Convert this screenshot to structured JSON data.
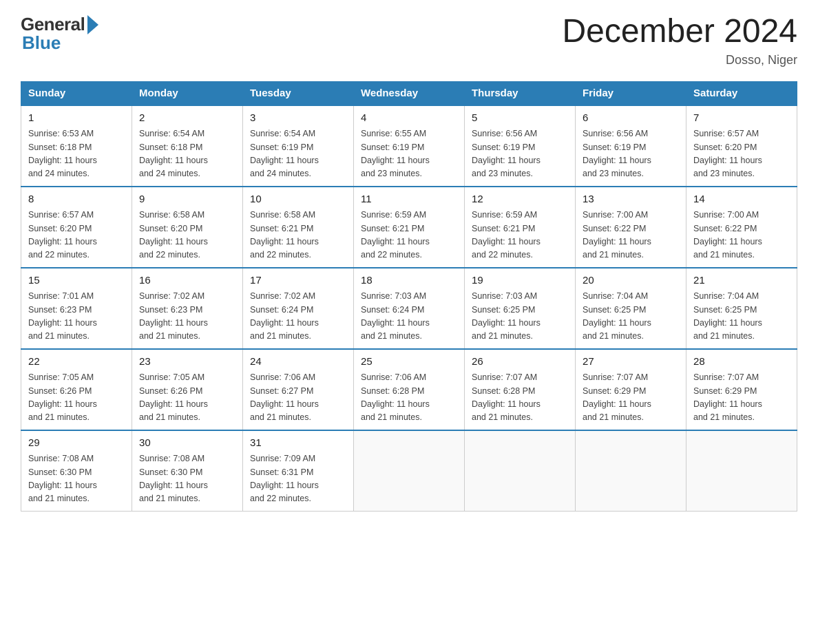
{
  "header": {
    "logo_general": "General",
    "logo_blue": "Blue",
    "title": "December 2024",
    "location": "Dosso, Niger"
  },
  "calendar": {
    "days_of_week": [
      "Sunday",
      "Monday",
      "Tuesday",
      "Wednesday",
      "Thursday",
      "Friday",
      "Saturday"
    ],
    "weeks": [
      [
        {
          "day": "1",
          "sunrise": "6:53 AM",
          "sunset": "6:18 PM",
          "daylight": "11 hours and 24 minutes."
        },
        {
          "day": "2",
          "sunrise": "6:54 AM",
          "sunset": "6:18 PM",
          "daylight": "11 hours and 24 minutes."
        },
        {
          "day": "3",
          "sunrise": "6:54 AM",
          "sunset": "6:19 PM",
          "daylight": "11 hours and 24 minutes."
        },
        {
          "day": "4",
          "sunrise": "6:55 AM",
          "sunset": "6:19 PM",
          "daylight": "11 hours and 23 minutes."
        },
        {
          "day": "5",
          "sunrise": "6:56 AM",
          "sunset": "6:19 PM",
          "daylight": "11 hours and 23 minutes."
        },
        {
          "day": "6",
          "sunrise": "6:56 AM",
          "sunset": "6:19 PM",
          "daylight": "11 hours and 23 minutes."
        },
        {
          "day": "7",
          "sunrise": "6:57 AM",
          "sunset": "6:20 PM",
          "daylight": "11 hours and 23 minutes."
        }
      ],
      [
        {
          "day": "8",
          "sunrise": "6:57 AM",
          "sunset": "6:20 PM",
          "daylight": "11 hours and 22 minutes."
        },
        {
          "day": "9",
          "sunrise": "6:58 AM",
          "sunset": "6:20 PM",
          "daylight": "11 hours and 22 minutes."
        },
        {
          "day": "10",
          "sunrise": "6:58 AM",
          "sunset": "6:21 PM",
          "daylight": "11 hours and 22 minutes."
        },
        {
          "day": "11",
          "sunrise": "6:59 AM",
          "sunset": "6:21 PM",
          "daylight": "11 hours and 22 minutes."
        },
        {
          "day": "12",
          "sunrise": "6:59 AM",
          "sunset": "6:21 PM",
          "daylight": "11 hours and 22 minutes."
        },
        {
          "day": "13",
          "sunrise": "7:00 AM",
          "sunset": "6:22 PM",
          "daylight": "11 hours and 21 minutes."
        },
        {
          "day": "14",
          "sunrise": "7:00 AM",
          "sunset": "6:22 PM",
          "daylight": "11 hours and 21 minutes."
        }
      ],
      [
        {
          "day": "15",
          "sunrise": "7:01 AM",
          "sunset": "6:23 PM",
          "daylight": "11 hours and 21 minutes."
        },
        {
          "day": "16",
          "sunrise": "7:02 AM",
          "sunset": "6:23 PM",
          "daylight": "11 hours and 21 minutes."
        },
        {
          "day": "17",
          "sunrise": "7:02 AM",
          "sunset": "6:24 PM",
          "daylight": "11 hours and 21 minutes."
        },
        {
          "day": "18",
          "sunrise": "7:03 AM",
          "sunset": "6:24 PM",
          "daylight": "11 hours and 21 minutes."
        },
        {
          "day": "19",
          "sunrise": "7:03 AM",
          "sunset": "6:25 PM",
          "daylight": "11 hours and 21 minutes."
        },
        {
          "day": "20",
          "sunrise": "7:04 AM",
          "sunset": "6:25 PM",
          "daylight": "11 hours and 21 minutes."
        },
        {
          "day": "21",
          "sunrise": "7:04 AM",
          "sunset": "6:25 PM",
          "daylight": "11 hours and 21 minutes."
        }
      ],
      [
        {
          "day": "22",
          "sunrise": "7:05 AM",
          "sunset": "6:26 PM",
          "daylight": "11 hours and 21 minutes."
        },
        {
          "day": "23",
          "sunrise": "7:05 AM",
          "sunset": "6:26 PM",
          "daylight": "11 hours and 21 minutes."
        },
        {
          "day": "24",
          "sunrise": "7:06 AM",
          "sunset": "6:27 PM",
          "daylight": "11 hours and 21 minutes."
        },
        {
          "day": "25",
          "sunrise": "7:06 AM",
          "sunset": "6:28 PM",
          "daylight": "11 hours and 21 minutes."
        },
        {
          "day": "26",
          "sunrise": "7:07 AM",
          "sunset": "6:28 PM",
          "daylight": "11 hours and 21 minutes."
        },
        {
          "day": "27",
          "sunrise": "7:07 AM",
          "sunset": "6:29 PM",
          "daylight": "11 hours and 21 minutes."
        },
        {
          "day": "28",
          "sunrise": "7:07 AM",
          "sunset": "6:29 PM",
          "daylight": "11 hours and 21 minutes."
        }
      ],
      [
        {
          "day": "29",
          "sunrise": "7:08 AM",
          "sunset": "6:30 PM",
          "daylight": "11 hours and 21 minutes."
        },
        {
          "day": "30",
          "sunrise": "7:08 AM",
          "sunset": "6:30 PM",
          "daylight": "11 hours and 21 minutes."
        },
        {
          "day": "31",
          "sunrise": "7:09 AM",
          "sunset": "6:31 PM",
          "daylight": "11 hours and 22 minutes."
        },
        null,
        null,
        null,
        null
      ]
    ],
    "labels": {
      "sunrise": "Sunrise:",
      "sunset": "Sunset:",
      "daylight": "Daylight:"
    }
  }
}
